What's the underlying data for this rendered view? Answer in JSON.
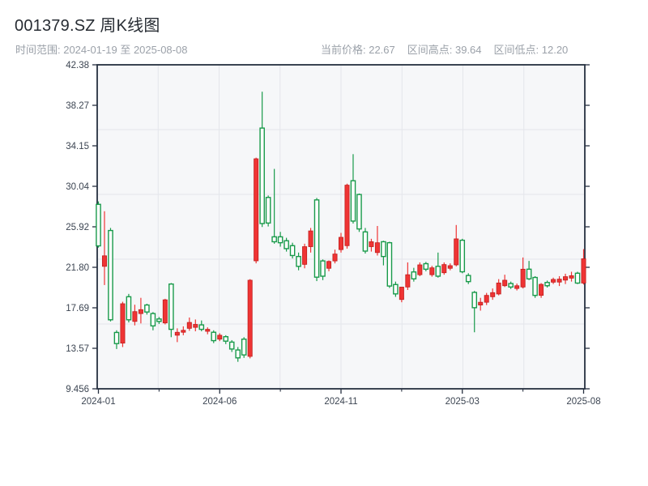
{
  "header": {
    "title": "001379.SZ 周K线图",
    "time_range": "时间范围: 2024-01-19 至 2025-08-08",
    "stats": [
      {
        "label": "当前价格",
        "value": "22.67",
        "text": "当前价格: 22.67"
      },
      {
        "label": "区间高点",
        "value": "39.64",
        "text": "区间高点: 39.64"
      },
      {
        "label": "区间低点",
        "value": "12.20",
        "text": "区间低点: 12.20"
      }
    ]
  },
  "chart_data": {
    "type": "candlestick",
    "symbol": "001379.SZ",
    "period": "weekly",
    "title": "001379.SZ 周K线图",
    "current_price": 22.67,
    "range_high": 39.64,
    "range_low": 12.2,
    "ylim": [
      9.456,
      42.38
    ],
    "y_tick_labels": [
      "42.38",
      "38.27",
      "34.15",
      "30.04",
      "25.92",
      "21.80",
      "17.69",
      "13.57",
      "9.456"
    ],
    "x_ticks": [
      {
        "label": "2024-01",
        "bar": 0
      },
      {
        "label": "2024-06",
        "bar": 20
      },
      {
        "label": "2024-11",
        "bar": 40
      },
      {
        "label": "2025-03",
        "bar": 60
      },
      {
        "label": "2025-08",
        "bar": 80
      }
    ],
    "legend": "none",
    "grid": "on",
    "colors": {
      "up": "#ef3434",
      "up_edge": "#c01f1f",
      "down": "#189a4a",
      "down_fill": "#ffffff",
      "grid": "#e4e6eb",
      "spine": "#263040",
      "plot_bg": "#f6f7f9",
      "tick_label": "#3c4552"
    },
    "columns": [
      "date",
      "open",
      "high",
      "low",
      "close"
    ],
    "candles": [
      [
        "2024-01-19",
        28.2,
        28.5,
        23.8,
        23.98
      ],
      [
        "2024-01-26",
        21.9,
        27.5,
        20.0,
        22.97
      ],
      [
        "2024-02-02",
        25.54,
        25.8,
        16.3,
        16.47
      ],
      [
        "2024-02-09",
        15.18,
        15.4,
        13.5,
        14.05
      ],
      [
        "2024-02-23",
        14.1,
        18.3,
        13.7,
        18.1
      ],
      [
        "2024-03-01",
        18.81,
        19.1,
        16.2,
        16.47
      ],
      [
        "2024-03-08",
        16.3,
        18.0,
        15.9,
        17.3
      ],
      [
        "2024-03-15",
        17.1,
        18.7,
        16.1,
        17.5
      ],
      [
        "2024-03-22",
        17.97,
        18.1,
        17.0,
        17.26
      ],
      [
        "2024-03-29",
        17.1,
        17.25,
        15.4,
        15.85
      ],
      [
        "2024-04-05",
        16.55,
        16.75,
        16.05,
        16.3
      ],
      [
        "2024-04-12",
        16.15,
        18.6,
        16.0,
        18.5
      ],
      [
        "2024-04-19",
        20.1,
        20.2,
        14.7,
        15.5
      ],
      [
        "2024-04-26",
        14.9,
        15.6,
        14.2,
        15.2
      ],
      [
        "2024-05-03",
        15.2,
        15.8,
        14.9,
        15.4
      ],
      [
        "2024-05-10",
        15.6,
        16.7,
        15.35,
        16.2
      ],
      [
        "2024-05-17",
        15.7,
        16.5,
        15.3,
        16.0
      ],
      [
        "2024-05-24",
        15.95,
        16.4,
        15.3,
        15.5
      ],
      [
        "2024-05-31",
        15.3,
        15.7,
        15.0,
        15.5
      ],
      [
        "2024-06-07",
        15.2,
        15.4,
        14.1,
        14.35
      ],
      [
        "2024-06-14",
        14.5,
        15.1,
        14.3,
        14.9
      ],
      [
        "2024-06-21",
        14.75,
        14.9,
        14.0,
        14.3
      ],
      [
        "2024-06-28",
        14.2,
        14.4,
        13.2,
        13.5
      ],
      [
        "2024-07-05",
        13.4,
        13.7,
        12.2,
        12.6
      ],
      [
        "2024-07-12",
        14.5,
        14.7,
        12.6,
        12.9
      ],
      [
        "2024-07-19",
        12.75,
        20.6,
        12.55,
        20.49
      ],
      [
        "2024-07-26",
        22.46,
        32.95,
        22.2,
        32.83
      ],
      [
        "2024-08-02",
        35.95,
        39.64,
        25.9,
        26.25
      ],
      [
        "2024-08-09",
        28.9,
        29.1,
        25.95,
        26.3
      ],
      [
        "2024-08-16",
        24.9,
        31.8,
        24.2,
        24.4
      ],
      [
        "2024-08-23",
        24.9,
        25.4,
        23.9,
        24.3
      ],
      [
        "2024-08-30",
        24.5,
        24.8,
        23.4,
        23.7
      ],
      [
        "2024-09-06",
        24.0,
        24.3,
        22.7,
        23.0
      ],
      [
        "2024-09-13",
        22.9,
        23.3,
        21.5,
        21.9
      ],
      [
        "2024-09-20",
        22.1,
        24.2,
        21.7,
        23.9
      ],
      [
        "2024-09-27",
        23.9,
        25.8,
        23.3,
        25.5
      ],
      [
        "2024-10-04",
        28.65,
        28.85,
        20.4,
        20.8
      ],
      [
        "2024-10-11",
        22.45,
        22.6,
        20.5,
        20.9
      ],
      [
        "2024-10-18",
        21.7,
        22.5,
        21.4,
        22.4
      ],
      [
        "2024-10-25",
        22.45,
        23.6,
        22.2,
        23.15
      ],
      [
        "2024-11-01",
        23.6,
        25.3,
        23.3,
        24.85
      ],
      [
        "2024-11-08",
        24.0,
        30.3,
        23.7,
        30.15
      ],
      [
        "2024-11-15",
        30.6,
        33.3,
        26.25,
        26.5
      ],
      [
        "2024-11-22",
        29.2,
        29.3,
        25.4,
        25.7
      ],
      [
        "2024-11-29",
        25.4,
        25.8,
        23.2,
        23.45
      ],
      [
        "2024-12-06",
        23.9,
        24.7,
        23.4,
        24.4
      ],
      [
        "2024-12-13",
        23.3,
        26.0,
        23.0,
        24.3
      ],
      [
        "2024-12-20",
        24.4,
        24.5,
        22.0,
        22.9
      ],
      [
        "2024-12-27",
        24.3,
        24.4,
        19.7,
        19.9
      ],
      [
        "2025-01-03",
        20.05,
        20.35,
        18.8,
        19.1
      ],
      [
        "2025-01-10",
        18.53,
        19.8,
        18.25,
        19.79
      ],
      [
        "2025-01-17",
        19.8,
        22.3,
        19.5,
        21.05
      ],
      [
        "2025-01-24",
        21.33,
        21.75,
        20.35,
        20.63
      ],
      [
        "2025-01-31",
        21.05,
        22.3,
        20.9,
        22.05
      ],
      [
        "2025-02-07",
        22.17,
        22.35,
        21.4,
        21.61
      ],
      [
        "2025-02-14",
        21.05,
        21.95,
        20.85,
        21.75
      ],
      [
        "2025-02-21",
        21.9,
        23.3,
        20.75,
        20.9
      ],
      [
        "2025-02-28",
        21.25,
        22.3,
        21.05,
        22.08
      ],
      [
        "2025-03-07",
        21.7,
        22.2,
        21.5,
        21.97
      ],
      [
        "2025-03-14",
        22.05,
        26.1,
        21.9,
        24.69
      ],
      [
        "2025-03-21",
        24.55,
        24.7,
        21.2,
        21.35
      ],
      [
        "2025-03-28",
        20.97,
        21.2,
        20.1,
        20.35
      ],
      [
        "2025-04-04",
        19.25,
        19.4,
        15.2,
        17.7
      ],
      [
        "2025-04-11",
        17.97,
        18.7,
        17.4,
        18.25
      ],
      [
        "2025-04-18",
        18.25,
        19.2,
        17.97,
        18.95
      ],
      [
        "2025-04-25",
        18.81,
        19.65,
        18.5,
        19.23
      ],
      [
        "2025-05-02",
        19.09,
        20.6,
        18.95,
        20.21
      ],
      [
        "2025-05-09",
        19.93,
        21.05,
        19.8,
        20.49
      ],
      [
        "2025-05-16",
        20.15,
        20.35,
        19.6,
        19.8
      ],
      [
        "2025-05-23",
        19.65,
        20.15,
        19.45,
        19.93
      ],
      [
        "2025-05-30",
        19.8,
        22.8,
        19.65,
        21.61
      ],
      [
        "2025-06-06",
        21.61,
        22.45,
        20.5,
        20.63
      ],
      [
        "2025-06-13",
        20.77,
        20.9,
        18.7,
        18.95
      ],
      [
        "2025-06-20",
        18.95,
        20.2,
        18.7,
        20.07
      ],
      [
        "2025-06-27",
        20.26,
        20.45,
        19.75,
        19.93
      ],
      [
        "2025-07-04",
        20.29,
        20.75,
        20.1,
        20.57
      ],
      [
        "2025-07-11",
        20.3,
        20.9,
        19.9,
        20.6
      ],
      [
        "2025-07-18",
        20.5,
        21.15,
        20.1,
        20.85
      ],
      [
        "2025-07-25",
        20.7,
        21.35,
        20.35,
        20.95
      ],
      [
        "2025-08-01",
        21.2,
        21.35,
        20.1,
        20.2
      ],
      [
        "2025-08-08",
        20.2,
        23.65,
        20.05,
        22.67
      ]
    ]
  }
}
